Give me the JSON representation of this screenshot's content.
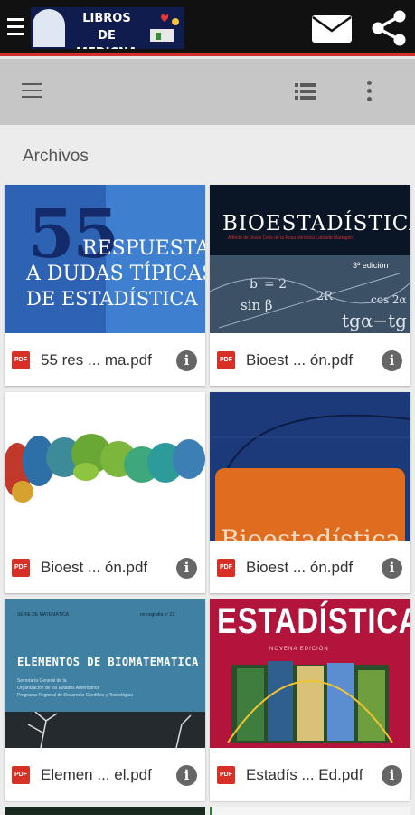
{
  "header": {
    "logo_text": "LIBROS DE MEDICNA",
    "mail_icon": "mail-icon",
    "share_icon": "share-icon"
  },
  "toolbar": {
    "menu_icon": "menu-icon",
    "view_icon": "list-view-icon",
    "more_icon": "more-vert-icon"
  },
  "section_title": "Archivos",
  "files": [
    {
      "name": "55 res ... ma.pdf",
      "type_badge": "PDF",
      "cover": {
        "num": "55",
        "line1": "RESPUESTAS",
        "line2": "A DUDAS TÍPICAS",
        "line3": "DE ESTADÍSTICA"
      }
    },
    {
      "name": "Bioest ... ón.pdf",
      "type_badge": "PDF",
      "cover": {
        "title": "BIOESTADÍSTICA",
        "authors": "Alfredo de Jesús Celis de la Rosa    Verónica Labrada Martagón",
        "edition": "3ª edición",
        "eq1": "b",
        "eq2": "sin β",
        "eq3": "2R",
        "eq4": "tgα−tg",
        "eq5": "cos 2α",
        "eq6": "= 2"
      }
    },
    {
      "name": "Bioest ... ón.pdf",
      "type_badge": "PDF",
      "cover": {}
    },
    {
      "name": "Bioest ... ón.pdf",
      "type_badge": "PDF",
      "cover": {
        "title": "Bioestadística"
      }
    },
    {
      "name": "Elemen ... el.pdf",
      "type_badge": "PDF",
      "cover": {
        "series": "SERIE DE MATEMÁTICA",
        "monograph": "monografía nº 22",
        "title": "ELEMENTOS DE BIOMATEMATICA",
        "l1": "Secretaría General de la",
        "l2": "Organización de los Estados Americanos",
        "l3": "Programa Regional de Desarrollo Científico y Tecnológico"
      }
    },
    {
      "name": "Estadís ... Ed.pdf",
      "type_badge": "PDF",
      "cover": {
        "title": "ESTADÍSTICA",
        "sub": "NOVENA EDICIÓN"
      }
    }
  ],
  "info_glyph": "i",
  "colors": {
    "accent": "#d32f2f",
    "pdf_red": "#d93025",
    "toolbar": "#c6c6c6"
  }
}
